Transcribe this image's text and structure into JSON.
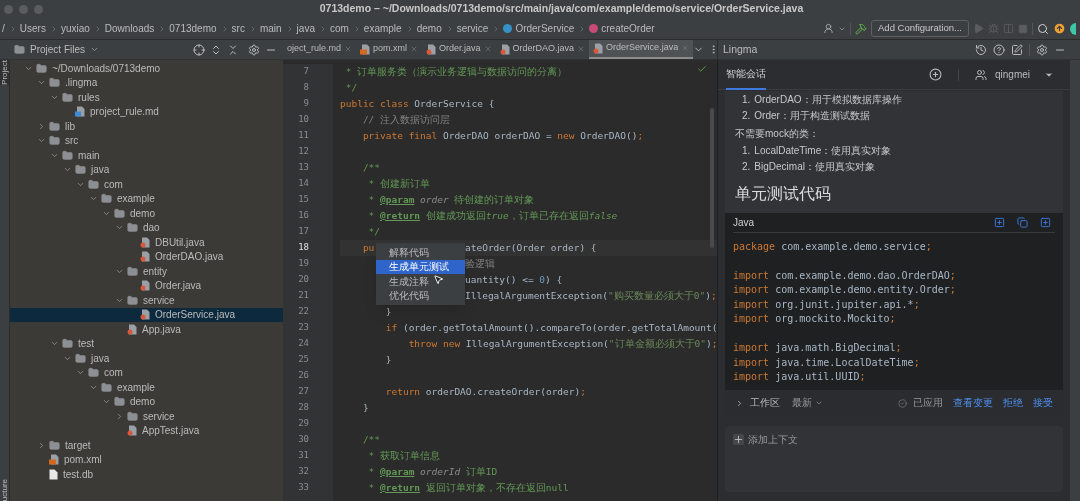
{
  "window": {
    "title": "0713demo – ~/Downloads/0713demo/src/main/java/com/example/demo/service/OrderService.java"
  },
  "breadcrumbs": [
    {
      "label": "/"
    },
    {
      "label": "Users",
      "kind": "folder"
    },
    {
      "label": "yuxiao",
      "kind": "folder"
    },
    {
      "label": "Downloads",
      "kind": "folder"
    },
    {
      "label": "0713demo",
      "kind": "folder"
    },
    {
      "label": "src",
      "kind": "folder"
    },
    {
      "label": "main",
      "kind": "folder"
    },
    {
      "label": "java",
      "kind": "folder"
    },
    {
      "label": "com",
      "kind": "folder"
    },
    {
      "label": "example",
      "kind": "folder"
    },
    {
      "label": "demo",
      "kind": "folder"
    },
    {
      "label": "service",
      "kind": "folder"
    },
    {
      "label": "OrderService",
      "kind": "class"
    },
    {
      "label": "createOrder",
      "kind": "method"
    }
  ],
  "toolbar": {
    "run_config": "Add Configuration..."
  },
  "side_strip": {
    "top": "Project",
    "bottom": "ucture"
  },
  "project_panel": {
    "title": "Project Files",
    "tree": [
      {
        "label": "~/Downloads/0713demo",
        "kind": "folder",
        "expanded": true,
        "selected": false,
        "children": [
          {
            "label": ".lingma",
            "kind": "folder",
            "expanded": true,
            "selected": false,
            "children": [
              {
                "label": "rules",
                "kind": "folder",
                "expanded": true,
                "selected": false,
                "children": [
                  {
                    "label": "project_rule.md",
                    "kind": "md",
                    "selected": false
                  }
                ]
              }
            ]
          },
          {
            "label": "lib",
            "kind": "folder",
            "expanded": false,
            "selected": false
          },
          {
            "label": "src",
            "kind": "folder",
            "expanded": true,
            "selected": false,
            "children": [
              {
                "label": "main",
                "kind": "folder",
                "expanded": true,
                "selected": false,
                "children": [
                  {
                    "label": "java",
                    "kind": "folder",
                    "expanded": true,
                    "selected": false,
                    "children": [
                      {
                        "label": "com",
                        "kind": "folder",
                        "expanded": true,
                        "selected": false,
                        "children": [
                          {
                            "label": "example",
                            "kind": "folder",
                            "expanded": true,
                            "selected": false,
                            "children": [
                              {
                                "label": "demo",
                                "kind": "folder",
                                "expanded": true,
                                "selected": false,
                                "children": [
                                  {
                                    "label": "dao",
                                    "kind": "folder",
                                    "expanded": true,
                                    "selected": false,
                                    "children": [
                                      {
                                        "label": "DBUtil.java",
                                        "kind": "java",
                                        "selected": false
                                      },
                                      {
                                        "label": "OrderDAO.java",
                                        "kind": "java",
                                        "selected": false
                                      }
                                    ]
                                  },
                                  {
                                    "label": "entity",
                                    "kind": "folder",
                                    "expanded": true,
                                    "selected": false,
                                    "children": [
                                      {
                                        "label": "Order.java",
                                        "kind": "java",
                                        "selected": false
                                      }
                                    ]
                                  },
                                  {
                                    "label": "service",
                                    "kind": "folder",
                                    "expanded": true,
                                    "selected": false,
                                    "children": [
                                      {
                                        "label": "OrderService.java",
                                        "kind": "java",
                                        "selected": true
                                      }
                                    ]
                                  },
                                  {
                                    "label": "App.java",
                                    "kind": "java",
                                    "selected": false
                                  }
                                ]
                              }
                            ]
                          }
                        ]
                      }
                    ]
                  }
                ]
              },
              {
                "label": "test",
                "kind": "folder",
                "expanded": true,
                "selected": false,
                "children": [
                  {
                    "label": "java",
                    "kind": "folder",
                    "expanded": true,
                    "selected": false,
                    "children": [
                      {
                        "label": "com",
                        "kind": "folder",
                        "expanded": true,
                        "selected": false,
                        "children": [
                          {
                            "label": "example",
                            "kind": "folder",
                            "expanded": true,
                            "selected": false,
                            "children": [
                              {
                                "label": "demo",
                                "kind": "folder",
                                "expanded": true,
                                "selected": false,
                                "children": [
                                  {
                                    "label": "service",
                                    "kind": "folder",
                                    "expanded": false,
                                    "selected": false
                                  },
                                  {
                                    "label": "AppTest.java",
                                    "kind": "java",
                                    "selected": false
                                  }
                                ]
                              }
                            ]
                          }
                        ]
                      }
                    ]
                  }
                ]
              }
            ]
          },
          {
            "label": "target",
            "kind": "folder",
            "expanded": false,
            "selected": false
          },
          {
            "label": "pom.xml",
            "kind": "xml",
            "selected": false
          },
          {
            "label": "test.db",
            "kind": "file",
            "selected": false
          }
        ]
      }
    ]
  },
  "editor": {
    "tabs": [
      {
        "label": "oject_rule.md",
        "selected": false
      },
      {
        "label": "pom.xml",
        "kind": "xml",
        "selected": false
      },
      {
        "label": "Order.java",
        "kind": "java",
        "selected": false
      },
      {
        "label": "OrderDAO.java",
        "kind": "java",
        "selected": false
      },
      {
        "label": "OrderService.java",
        "kind": "java",
        "selected": true
      }
    ],
    "lines": [
      {
        "number": "7",
        "current": false,
        "tokens": [
          {
            "kind": "doc",
            "text": " * 订单服务类（演示业务逻辑与数据访问的分离）"
          }
        ]
      },
      {
        "number": "8",
        "current": false,
        "tokens": [
          {
            "kind": "doc",
            "text": " */"
          }
        ]
      },
      {
        "number": "9",
        "current": false,
        "tokens": [
          {
            "kind": "kw",
            "text": "public class "
          },
          {
            "kind": "plain",
            "text": "OrderService {"
          }
        ]
      },
      {
        "number": "10",
        "current": false,
        "tokens": [
          {
            "kind": "comment",
            "text": "    // 注入数据访问层"
          }
        ]
      },
      {
        "number": "11",
        "current": false,
        "tokens": [
          {
            "kind": "kw",
            "text": "    private final "
          },
          {
            "kind": "plain",
            "text": "OrderDAO orderDAO = "
          },
          {
            "kind": "kw",
            "text": "new "
          },
          {
            "kind": "plain",
            "text": "OrderDAO()"
          },
          {
            "kind": "kw",
            "text": ";"
          }
        ]
      },
      {
        "number": "12",
        "current": false
      },
      {
        "number": "13",
        "current": false,
        "tokens": [
          {
            "kind": "doc",
            "text": "    /**"
          }
        ]
      },
      {
        "number": "14",
        "current": false,
        "tokens": [
          {
            "kind": "doc",
            "text": "     * 创建新订单"
          }
        ]
      },
      {
        "number": "15",
        "current": false,
        "tokens": [
          {
            "kind": "doc",
            "text": "     * "
          },
          {
            "kind": "tag",
            "text": "@param"
          },
          {
            "kind": "param",
            "text": " order"
          },
          {
            "kind": "doc",
            "text": " 待创建的订单对象"
          }
        ]
      },
      {
        "number": "16",
        "current": false,
        "tokens": [
          {
            "kind": "doc",
            "text": "     * "
          },
          {
            "kind": "tag",
            "text": "@return"
          },
          {
            "kind": "doc",
            "text": " 创建成功返回"
          },
          {
            "kind": "doc_italic",
            "text": "true"
          },
          {
            "kind": "doc",
            "text": "，订单已存在返回"
          },
          {
            "kind": "doc_italic",
            "text": "false"
          }
        ]
      },
      {
        "number": "17",
        "current": false,
        "tokens": [
          {
            "kind": "doc",
            "text": "     */"
          }
        ]
      },
      {
        "number": "18",
        "current": true,
        "tokens": [
          {
            "kind": "kw",
            "text": "    pu"
          }
        ],
        "after": [
          {
            "kind": "plain",
            "text": "ateOrder(Order order) {"
          }
        ]
      },
      {
        "number": "19",
        "current": false,
        "after": [
          {
            "kind": "comment",
            "text": "验逻辑"
          }
        ]
      },
      {
        "number": "20",
        "current": false,
        "after": [
          {
            "kind": "plain",
            "text": "uantity() <= "
          },
          {
            "kind": "num",
            "text": "0"
          },
          {
            "kind": "plain",
            "text": ") {"
          }
        ]
      },
      {
        "number": "21",
        "current": false,
        "after": [
          {
            "kind": "plain",
            "text": "IllegalArgumentException("
          },
          {
            "kind": "str",
            "text": "\"购买数量必须大于0\""
          },
          {
            "kind": "plain",
            "text": ")"
          },
          {
            "kind": "kw",
            "text": ";"
          }
        ]
      },
      {
        "number": "22",
        "current": false,
        "tokens": [
          {
            "kind": "plain",
            "text": "        }"
          }
        ]
      },
      {
        "number": "23",
        "current": false,
        "tokens": [
          {
            "kind": "kw",
            "text": "        if "
          },
          {
            "kind": "plain",
            "text": "(order.getTotalAmount().compareTo(order.getTotalAmount("
          }
        ]
      },
      {
        "number": "24",
        "current": false,
        "tokens": [
          {
            "kind": "kw",
            "text": "            throw new "
          },
          {
            "kind": "plain",
            "text": "IllegalArgumentException("
          },
          {
            "kind": "str",
            "text": "\"订单金额必须大于0\""
          },
          {
            "kind": "plain",
            "text": ")"
          },
          {
            "kind": "kw",
            "text": ";"
          }
        ]
      },
      {
        "number": "25",
        "current": false,
        "tokens": [
          {
            "kind": "plain",
            "text": "        }"
          }
        ]
      },
      {
        "number": "26",
        "current": false
      },
      {
        "number": "27",
        "current": false,
        "tokens": [
          {
            "kind": "kw",
            "text": "        return "
          },
          {
            "kind": "plain",
            "text": "orderDAO.createOrder(order)"
          },
          {
            "kind": "kw",
            "text": ";"
          }
        ]
      },
      {
        "number": "28",
        "current": false,
        "tokens": [
          {
            "kind": "plain",
            "text": "    }"
          }
        ]
      },
      {
        "number": "29",
        "current": false
      },
      {
        "number": "30",
        "current": false,
        "tokens": [
          {
            "kind": "doc",
            "text": "    /**"
          }
        ]
      },
      {
        "number": "31",
        "current": false,
        "tokens": [
          {
            "kind": "doc",
            "text": "     * 获取订单信息"
          }
        ]
      },
      {
        "number": "32",
        "current": false,
        "tokens": [
          {
            "kind": "doc",
            "text": "     * "
          },
          {
            "kind": "tag",
            "text": "@param"
          },
          {
            "kind": "param",
            "text": " orderId"
          },
          {
            "kind": "doc",
            "text": " 订单ID"
          }
        ]
      },
      {
        "number": "33",
        "current": false,
        "tokens": [
          {
            "kind": "doc",
            "text": "     * "
          },
          {
            "kind": "tag",
            "text": "@return"
          },
          {
            "kind": "doc",
            "text": " 返回订单对象，不存在返回null"
          }
        ]
      }
    ],
    "popup": [
      {
        "label": "解释代码",
        "selected": false
      },
      {
        "label": "生成单元测试",
        "selected": true
      },
      {
        "label": "生成注释",
        "selected": false
      },
      {
        "label": "优化代码",
        "selected": false
      }
    ]
  },
  "assistant": {
    "title": "Lingma",
    "tab": "智能会话",
    "user": "qingmei",
    "content": [
      {
        "kind": "list_item",
        "marker": "1.",
        "text": "OrderDAO：用于模拟数据库操作"
      },
      {
        "kind": "list_item",
        "marker": "2.",
        "text": "Order：用于构造测试数据"
      },
      {
        "kind": "paragraph",
        "text": "不需要mock的类："
      },
      {
        "kind": "list_item",
        "marker": "1.",
        "text": "LocalDateTime：使用真实对象"
      },
      {
        "kind": "list_item",
        "marker": "2.",
        "text": "BigDecimal：使用真实对象"
      },
      {
        "kind": "heading",
        "text": "单元测试代码"
      }
    ],
    "code_block": {
      "language": "Java",
      "lines": [
        {
          "kind": "code",
          "tokens": [
            {
              "kind": "kw",
              "text": "package "
            },
            {
              "kind": "plain",
              "text": "com.example.demo.service"
            },
            {
              "kind": "kw",
              "text": ";"
            }
          ]
        },
        {
          "kind": "blank"
        },
        {
          "kind": "code",
          "tokens": [
            {
              "kind": "kw",
              "text": "import "
            },
            {
              "kind": "plain",
              "text": "com.example.demo.dao.OrderDAO"
            },
            {
              "kind": "kw",
              "text": ";"
            }
          ]
        },
        {
          "kind": "code",
          "tokens": [
            {
              "kind": "kw",
              "text": "import "
            },
            {
              "kind": "plain",
              "text": "com.example.demo.entity.Order"
            },
            {
              "kind": "kw",
              "text": ";"
            }
          ]
        },
        {
          "kind": "code",
          "tokens": [
            {
              "kind": "kw",
              "text": "import "
            },
            {
              "kind": "plain",
              "text": "org.junit.jupiter.api.*"
            },
            {
              "kind": "kw",
              "text": ";"
            }
          ]
        },
        {
          "kind": "code",
          "tokens": [
            {
              "kind": "kw",
              "text": "import "
            },
            {
              "kind": "plain",
              "text": "org.mockito.Mockito"
            },
            {
              "kind": "kw",
              "text": ";"
            }
          ]
        },
        {
          "kind": "blank"
        },
        {
          "kind": "code",
          "tokens": [
            {
              "kind": "kw",
              "text": "import "
            },
            {
              "kind": "plain",
              "text": "java.math.BigDecimal"
            },
            {
              "kind": "kw",
              "text": ";"
            }
          ]
        },
        {
          "kind": "code",
          "tokens": [
            {
              "kind": "kw",
              "text": "import "
            },
            {
              "kind": "plain",
              "text": "java.time.LocalDateTime"
            },
            {
              "kind": "kw",
              "text": ";"
            }
          ]
        },
        {
          "kind": "code",
          "tokens": [
            {
              "kind": "kw",
              "text": "import "
            },
            {
              "kind": "plain",
              "text": "java.util.UUID"
            },
            {
              "kind": "kw",
              "text": ";"
            }
          ]
        }
      ]
    },
    "workspace": {
      "label": "工作区",
      "version": "最新",
      "status": "已应用",
      "actions": [
        "查看变更",
        "拒绝",
        "接受"
      ]
    },
    "input": {
      "add_context": "添加上下文"
    }
  }
}
